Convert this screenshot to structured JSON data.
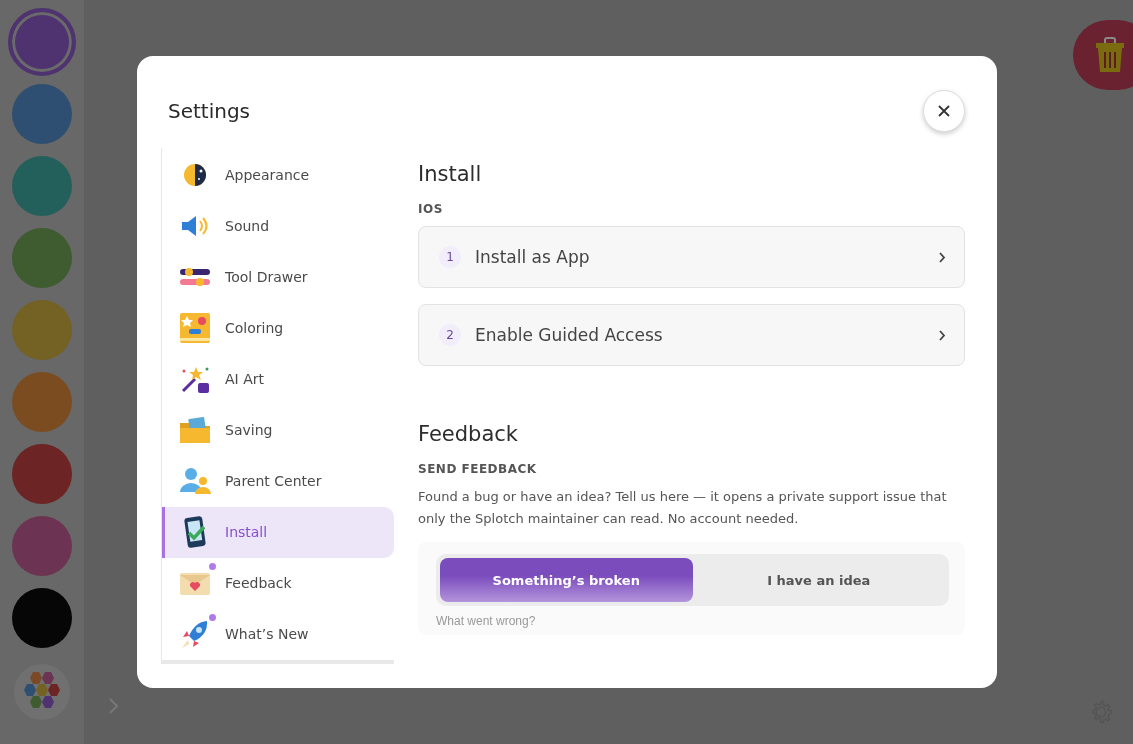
{
  "palette": {
    "swatches": [
      {
        "color": "#4f3270",
        "selected": true
      },
      {
        "color": "#2f4f72",
        "selected": false
      },
      {
        "color": "#23605c",
        "selected": false
      },
      {
        "color": "#3f5b30",
        "selected": false
      },
      {
        "color": "#746224",
        "selected": false
      },
      {
        "color": "#7b4c20",
        "selected": false
      },
      {
        "color": "#6c2424",
        "selected": false
      },
      {
        "color": "#6c3452",
        "selected": false
      },
      {
        "color": "#060606",
        "selected": false
      }
    ]
  },
  "settings": {
    "title": "Settings",
    "nav": [
      {
        "label": "Appearance",
        "selected": false,
        "badge": false
      },
      {
        "label": "Sound",
        "selected": false,
        "badge": false
      },
      {
        "label": "Tool Drawer",
        "selected": false,
        "badge": false
      },
      {
        "label": "Coloring",
        "selected": false,
        "badge": false
      },
      {
        "label": "AI Art",
        "selected": false,
        "badge": false
      },
      {
        "label": "Saving",
        "selected": false,
        "badge": false
      },
      {
        "label": "Parent Center",
        "selected": false,
        "badge": false
      },
      {
        "label": "Install",
        "selected": true,
        "badge": false
      },
      {
        "label": "Feedback",
        "selected": false,
        "badge": true
      },
      {
        "label": "What’s New",
        "selected": false,
        "badge": true
      }
    ],
    "install": {
      "heading": "Install",
      "subheading": "IOS",
      "steps": [
        {
          "number": "1",
          "label": "Install as App"
        },
        {
          "number": "2",
          "label": "Enable Guided Access"
        }
      ]
    },
    "feedback": {
      "heading": "Feedback",
      "subheading": "SEND FEEDBACK",
      "description": "Found a bug or have an idea? Tell us here — it opens a private support issue that only the Splotch maintainer can read. No account needed.",
      "options": [
        {
          "label": "Something’s broken",
          "selected": true
        },
        {
          "label": "I have an idea",
          "selected": false
        }
      ],
      "placeholder": "What went wrong?"
    }
  }
}
